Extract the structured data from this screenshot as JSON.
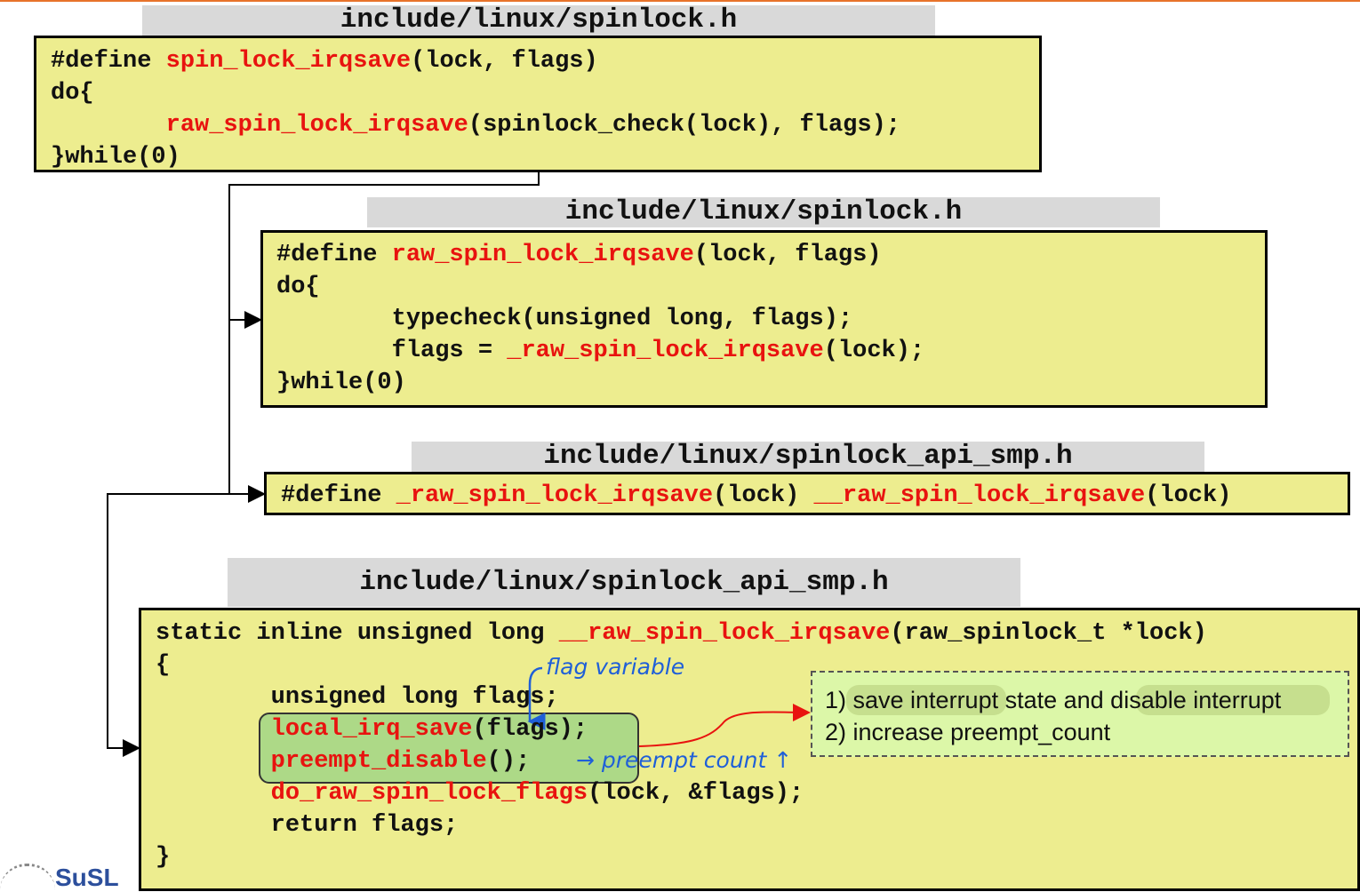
{
  "blocks": [
    {
      "file": "include/linux/spinlock.h",
      "lines": [
        [
          {
            "t": "#define "
          },
          {
            "t": "spin_lock_irqsave",
            "red": true
          },
          {
            "t": "(lock, flags)"
          }
        ],
        [
          {
            "t": "do{"
          }
        ],
        [
          {
            "t": "        "
          },
          {
            "t": "raw_spin_lock_irqsave",
            "red": true
          },
          {
            "t": "(spinlock_check(lock), flags);"
          }
        ],
        [
          {
            "t": "}while(0)"
          }
        ]
      ]
    },
    {
      "file": "include/linux/spinlock.h",
      "lines": [
        [
          {
            "t": "#define "
          },
          {
            "t": "raw_spin_lock_irqsave",
            "red": true
          },
          {
            "t": "(lock, flags)"
          }
        ],
        [
          {
            "t": "do{"
          }
        ],
        [
          {
            "t": "        typecheck(unsigned long, flags);"
          }
        ],
        [
          {
            "t": "        flags = "
          },
          {
            "t": "_raw_spin_lock_irqsave",
            "red": true
          },
          {
            "t": "(lock);"
          }
        ],
        [
          {
            "t": "}while(0)"
          }
        ]
      ]
    },
    {
      "file": "include/linux/spinlock_api_smp.h",
      "lines": [
        [
          {
            "t": "#define "
          },
          {
            "t": "_raw_spin_lock_irqsave",
            "red": true
          },
          {
            "t": "(lock) "
          },
          {
            "t": "__raw_spin_lock_irqsave",
            "red": true
          },
          {
            "t": "(lock)"
          }
        ]
      ]
    },
    {
      "file": "include/linux/spinlock_api_smp.h",
      "lines": [
        [
          {
            "t": "static inline unsigned long "
          },
          {
            "t": "__raw_spin_lock_irqsave",
            "red": true
          },
          {
            "t": "(raw_spinlock_t *lock)"
          }
        ],
        [
          {
            "t": "{"
          }
        ],
        [
          {
            "t": "        unsigned long flags;"
          }
        ],
        [
          {
            "t": "        "
          },
          {
            "t": "local_irq_save",
            "red": true
          },
          {
            "t": "(flags);"
          }
        ],
        [
          {
            "t": "        "
          },
          {
            "t": "preempt_disable",
            "red": true
          },
          {
            "t": "();"
          }
        ],
        [
          {
            "t": "        "
          },
          {
            "t": "do_raw_spin_lock_flags",
            "red": true
          },
          {
            "t": "(lock, &flags);"
          }
        ],
        [
          {
            "t": "        return flags;"
          }
        ],
        [
          {
            "t": "}"
          }
        ]
      ]
    }
  ],
  "callout": {
    "lines": [
      "1) save interrupt state and disable interrupt",
      "2) increase preempt_count"
    ]
  },
  "annotations": {
    "flag_note": "flag variable",
    "preempt_note": "→ preempt count ↑"
  },
  "logo": {
    "text": "SuSL"
  },
  "colors": {
    "code_bg": "#eded8f",
    "file_tab_bg": "#d9d9d9",
    "keyword": "#e8130f",
    "callout_bg": "#dcf7a8",
    "annotation": "#1f5fd8",
    "arrow": "#e8130f"
  }
}
